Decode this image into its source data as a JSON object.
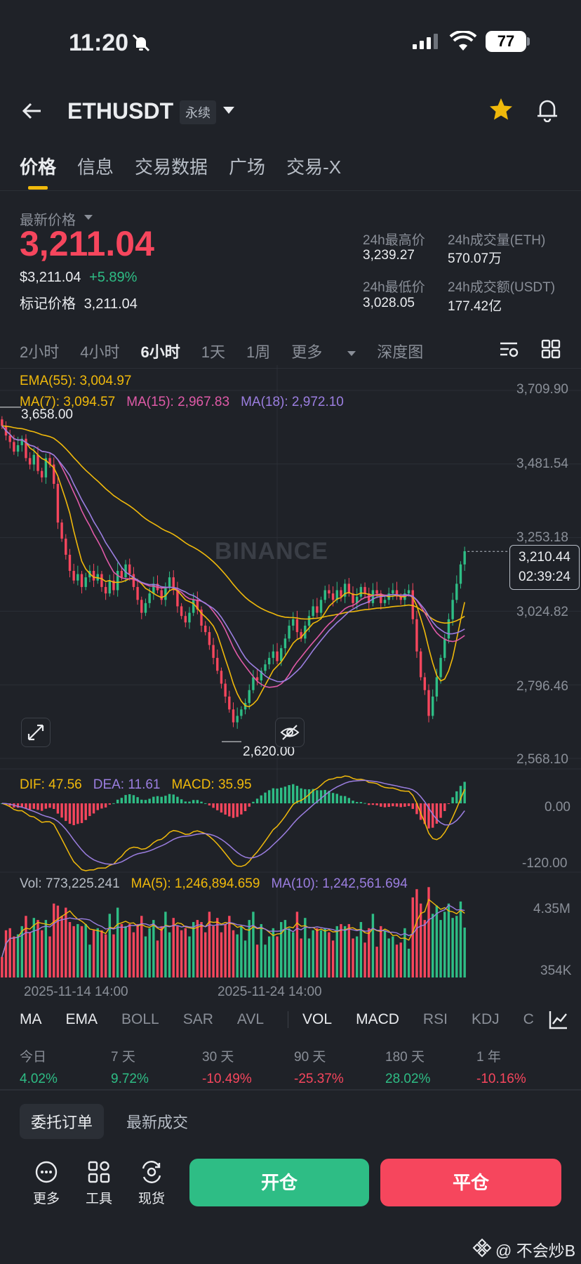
{
  "status_bar": {
    "time": "11:20",
    "battery": "77"
  },
  "header": {
    "symbol": "ETHUSDT",
    "contract_type": "永续"
  },
  "tabs": [
    {
      "label": "价格",
      "active": true
    },
    {
      "label": "信息",
      "active": false
    },
    {
      "label": "交易数据",
      "active": false
    },
    {
      "label": "广场",
      "active": false
    },
    {
      "label": "交易-X",
      "active": false
    }
  ],
  "price": {
    "latest_label": "最新价格",
    "last": "3,211.04",
    "usd": "$3,211.04",
    "change": "+5.89%",
    "mark_label": "标记价格",
    "mark_value": "3,211.04"
  },
  "stats": {
    "high_label": "24h最高价",
    "high_value": "3,239.27",
    "low_label": "24h最低价",
    "low_value": "3,028.05",
    "vol_eth_label": "24h成交量(ETH)",
    "vol_eth_value": "570.07万",
    "vol_usdt_label": "24h成交额(USDT)",
    "vol_usdt_value": "177.42亿"
  },
  "intervals": [
    {
      "label": "2小时",
      "active": false
    },
    {
      "label": "4小时",
      "active": false
    },
    {
      "label": "6小时",
      "active": true
    },
    {
      "label": "1天",
      "active": false
    },
    {
      "label": "1周",
      "active": false
    }
  ],
  "interval_more": "更多",
  "depth_label": "深度图",
  "indicators": {
    "ema": "EMA(55): 3,004.97",
    "ma7": "MA(7): 3,094.57",
    "ma15": "MA(15): 2,967.83",
    "ma18": "MA(18): 2,972.10",
    "dif": "DIF: 47.56",
    "dea": "DEA: 11.61",
    "macd": "MACD: 35.95",
    "vol": "Vol: 773,225.241",
    "vol_ma5": "MA(5): 1,246,894.659",
    "vol_ma10": "MA(10): 1,242,561.694"
  },
  "chart_labels": {
    "high_marker": "3,658.00",
    "low_marker": "2,620.00",
    "price_tag": "3,210.44",
    "countdown": "02:39:24",
    "watermark": "BINANCE"
  },
  "y_axis": [
    "3,709.90",
    "3,481.54",
    "3,253.18",
    "3,024.82",
    "2,796.46",
    "2,568.10"
  ],
  "macd_axis": [
    "0.00",
    "-120.00"
  ],
  "vol_axis": [
    "4.35M",
    "354K"
  ],
  "dates": [
    "2025-11-14 14:00",
    "2025-11-24 14:00"
  ],
  "indicator_tabs": [
    {
      "label": "MA",
      "on": true
    },
    {
      "label": "EMA",
      "on": true
    },
    {
      "label": "BOLL",
      "on": false
    },
    {
      "label": "SAR",
      "on": false
    },
    {
      "label": "AVL",
      "on": false
    },
    {
      "label": "VOL",
      "on": true
    },
    {
      "label": "MACD",
      "on": true
    },
    {
      "label": "RSI",
      "on": false
    },
    {
      "label": "KDJ",
      "on": false
    },
    {
      "label": "C",
      "on": false
    }
  ],
  "performance": [
    {
      "label": "今日",
      "value": "4.02%",
      "positive": true
    },
    {
      "label": "7 天",
      "value": "9.72%",
      "positive": true
    },
    {
      "label": "30 天",
      "value": "-10.49%",
      "positive": false
    },
    {
      "label": "90 天",
      "value": "-25.37%",
      "positive": false
    },
    {
      "label": "180 天",
      "value": "28.02%",
      "positive": true
    },
    {
      "label": "1 年",
      "value": "-10.16%",
      "positive": false
    }
  ],
  "orders": {
    "active": "委托订单",
    "other": "最新成交"
  },
  "bottom": {
    "more": "更多",
    "tools": "工具",
    "spot": "现货",
    "open": "开仓",
    "close": "平仓"
  },
  "credit": "@ 不会炒B",
  "colors": {
    "up": "#2ebd85",
    "down": "#f6465d",
    "accent": "#f0b90b",
    "ma15": "#e05aa8",
    "ma18": "#9b7ee0"
  },
  "chart_data": {
    "type": "candlestick",
    "interval": "6h",
    "price_range": [
      2568.1,
      3709.9
    ],
    "y_ticks": [
      3709.9,
      3481.54,
      3253.18,
      3024.82,
      2796.46,
      2568.1
    ],
    "high_marker": 3658.0,
    "low_marker": 2620.0,
    "last_price": 3210.44,
    "close": [
      3600,
      3570,
      3550,
      3520,
      3540,
      3560,
      3500,
      3480,
      3510,
      3460,
      3440,
      3500,
      3480,
      3420,
      3300,
      3250,
      3200,
      3150,
      3120,
      3140,
      3100,
      3130,
      3150,
      3120,
      3140,
      3100,
      3080,
      3120,
      3090,
      3150,
      3130,
      3170,
      3140,
      3100,
      3060,
      3020,
      3050,
      3080,
      3110,
      3090,
      3060,
      3100,
      3130,
      3090,
      3040,
      3010,
      2990,
      3020,
      3060,
      3030,
      2980,
      2960,
      2920,
      2880,
      2840,
      2800,
      2760,
      2720,
      2680,
      2700,
      2720,
      2740,
      2780,
      2820,
      2810,
      2840,
      2860,
      2880,
      2900,
      2870,
      2910,
      2940,
      2980,
      3000,
      2960,
      2940,
      2980,
      3010,
      3040,
      3020,
      3060,
      3090,
      3080,
      3060,
      3090,
      3070,
      3110,
      3080,
      3050,
      3070,
      3100,
      3080,
      3050,
      3090,
      3080,
      3050,
      3060,
      3080,
      3090,
      3070,
      3060,
      3080,
      3090,
      3000,
      2900,
      2820,
      2780,
      2700,
      2760,
      2820,
      2880,
      2940,
      3000,
      3060,
      3110,
      3170,
      3211
    ],
    "ema55_last": 3004.97,
    "ma7_last": 3094.57,
    "ma15_last": 2967.83,
    "ma18_last": 2972.1,
    "macd": {
      "dif": 47.56,
      "dea": 11.61,
      "macd": 35.95,
      "range": [
        -120,
        30
      ]
    },
    "volume": {
      "last": 773225.241,
      "ma5": 1246894.659,
      "ma10": 1242561.694,
      "range": [
        354000,
        4350000
      ]
    }
  }
}
